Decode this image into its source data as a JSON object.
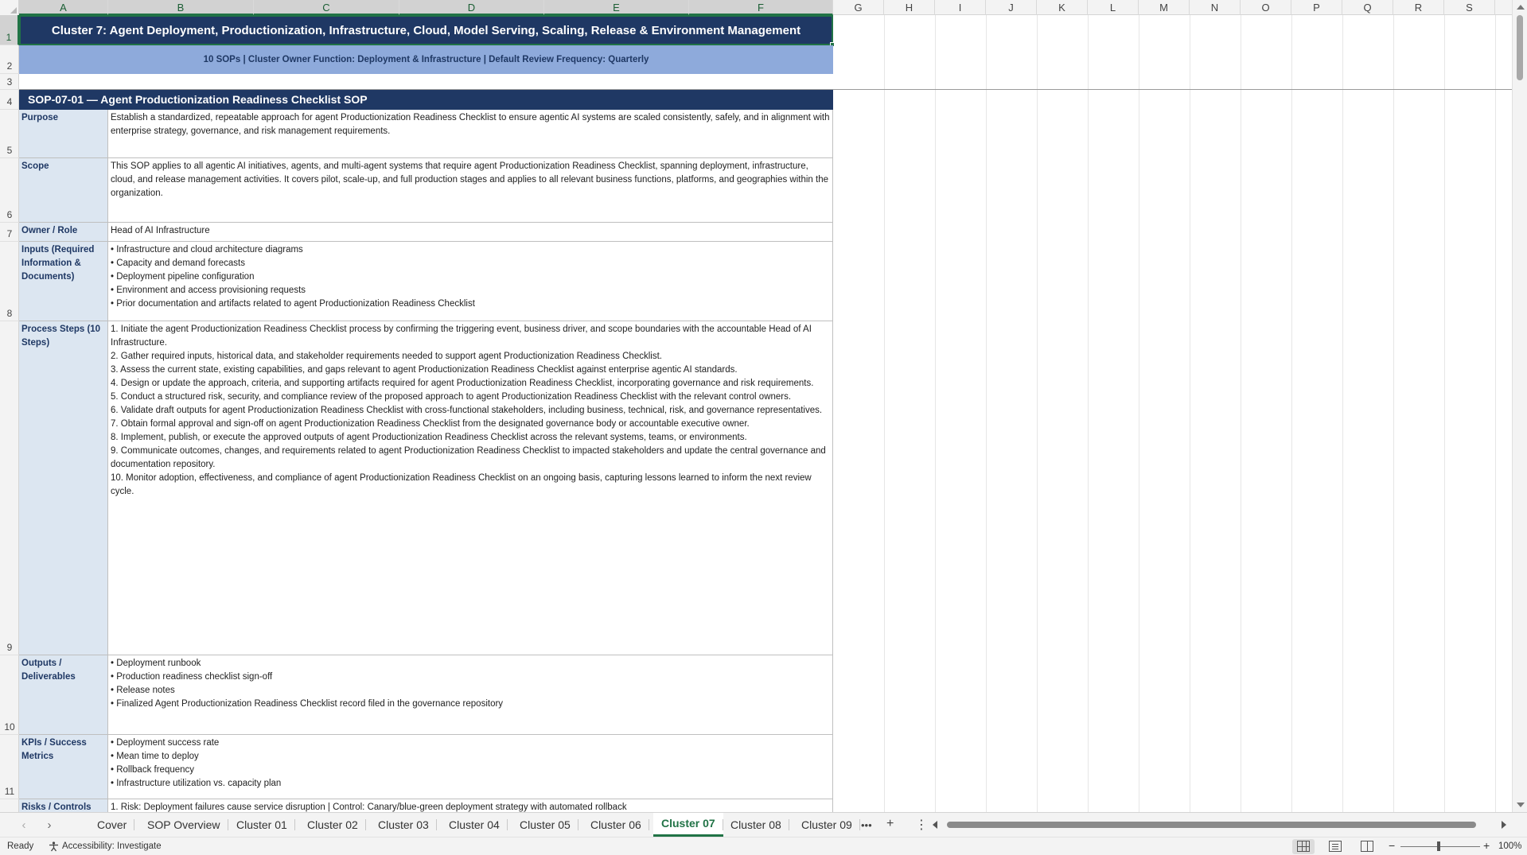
{
  "columns": [
    "A",
    "B",
    "C",
    "D",
    "E",
    "F",
    "G",
    "H",
    "I",
    "J",
    "K",
    "L",
    "M",
    "N",
    "O",
    "P",
    "Q",
    "R",
    "S"
  ],
  "rows": [
    "1",
    "2",
    "3",
    "4",
    "5",
    "6",
    "7",
    "8",
    "9",
    "10",
    "11"
  ],
  "title": "Cluster 7: Agent Deployment, Productionization, Infrastructure, Cloud, Model Serving, Scaling, Release & Environment Management",
  "subtitle": "10 SOPs  |  Cluster Owner Function: Deployment & Infrastructure  |  Default Review Frequency: Quarterly",
  "sop_header": "SOP-07-01  —  Agent Productionization Readiness Checklist SOP",
  "fields": {
    "purpose": {
      "label": "Purpose",
      "value": "Establish a standardized, repeatable approach for agent Productionization Readiness Checklist to ensure agentic AI systems are scaled consistently, safely, and in alignment with enterprise strategy, governance, and risk management requirements."
    },
    "scope": {
      "label": "Scope",
      "value": "This SOP applies to all agentic AI initiatives, agents, and multi-agent systems that require agent Productionization Readiness Checklist, spanning deployment, infrastructure, cloud, and release management activities. It covers pilot, scale-up, and full production stages and applies to all relevant business functions, platforms, and geographies within the organization."
    },
    "owner": {
      "label": "Owner / Role",
      "value": "Head of AI Infrastructure"
    },
    "inputs": {
      "label": "Inputs (Required Information & Documents)",
      "items": [
        "• Infrastructure and cloud architecture diagrams",
        "• Capacity and demand forecasts",
        "• Deployment pipeline configuration",
        "• Environment and access provisioning requests",
        "• Prior documentation and artifacts related to agent Productionization Readiness Checklist"
      ]
    },
    "process": {
      "label": "Process Steps (10 Steps)",
      "items": [
        "1. Initiate the agent Productionization Readiness Checklist process by confirming the triggering event, business driver, and scope boundaries with the accountable Head of AI Infrastructure.",
        "2. Gather required inputs, historical data, and stakeholder requirements needed to support agent Productionization Readiness Checklist.",
        "3. Assess the current state, existing capabilities, and gaps relevant to agent Productionization Readiness Checklist against enterprise agentic AI standards.",
        "4. Design or update the approach, criteria, and supporting artifacts required for agent Productionization Readiness Checklist, incorporating governance and risk requirements.",
        "5. Conduct a structured risk, security, and compliance review of the proposed approach to agent Productionization Readiness Checklist with the relevant control owners.",
        "6. Validate draft outputs for agent Productionization Readiness Checklist with cross-functional stakeholders, including business, technical, risk, and governance representatives.",
        "7. Obtain formal approval and sign-off on agent Productionization Readiness Checklist from the designated governance body or accountable executive owner.",
        "8. Implement, publish, or execute the approved outputs of agent Productionization Readiness Checklist across the relevant systems, teams, or environments.",
        "9. Communicate outcomes, changes, and requirements related to agent Productionization Readiness Checklist to impacted stakeholders and update the central governance and documentation repository.",
        "10. Monitor adoption, effectiveness, and compliance of agent Productionization Readiness Checklist on an ongoing basis, capturing lessons learned to inform the next review cycle."
      ]
    },
    "outputs": {
      "label": "Outputs / Deliverables",
      "items": [
        "• Deployment runbook",
        "• Production readiness checklist sign-off",
        "• Release notes",
        "• Finalized Agent Productionization Readiness Checklist record filed in the governance repository"
      ]
    },
    "kpis": {
      "label": "KPIs / Success Metrics",
      "items": [
        "• Deployment success rate",
        "• Mean time to deploy",
        "• Rollback frequency",
        "• Infrastructure utilization vs. capacity plan"
      ]
    },
    "risks": {
      "label": "Risks / Controls",
      "value": "1. Risk: Deployment failures cause service disruption  |  Control: Canary/blue-green deployment strategy with automated rollback"
    }
  },
  "tabs": [
    "Cover",
    "SOP Overview",
    "Cluster 01",
    "Cluster 02",
    "Cluster 03",
    "Cluster 04",
    "Cluster 05",
    "Cluster 06",
    "Cluster 07",
    "Cluster 08",
    "Cluster 09"
  ],
  "active_tab": "Cluster 07",
  "tab_more": "•••",
  "tab_add": "+",
  "tab_options": "⋮",
  "nav_prev": "‹",
  "nav_next": "›",
  "status": {
    "ready": "Ready",
    "accessibility": "Accessibility: Investigate",
    "zoom_minus": "−",
    "zoom_plus": "+",
    "zoom": "100%"
  },
  "colors": {
    "title_bg": "#1f3864",
    "subtitle_bg": "#8eaadb",
    "label_bg": "#dce6f1",
    "accent": "#217346"
  },
  "icons": [
    "accessibility-icon",
    "normal-view-icon",
    "page-layout-icon",
    "page-break-icon"
  ]
}
